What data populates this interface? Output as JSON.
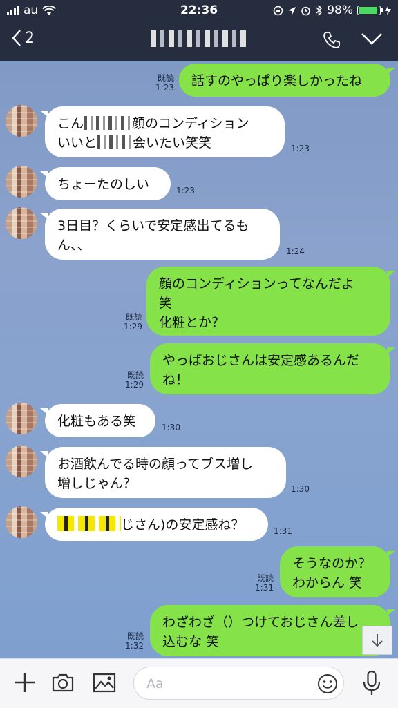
{
  "status": {
    "carrier": "au",
    "time": "22:36",
    "battery": "98%",
    "battery_level": 0.98
  },
  "header": {
    "back_count": "2"
  },
  "messages": [
    {
      "side": "out",
      "text": "話すのやっぱり楽しかったね",
      "read": "既読",
      "time": "1:23"
    },
    {
      "side": "in",
      "pre": "こん",
      "mid": "顔のコンディション\nいいと",
      "post": "会いたい笑笑",
      "time": "1:23"
    },
    {
      "side": "in",
      "text": "ちょーたのしい",
      "time": "1:23"
    },
    {
      "side": "in",
      "text": "3日目？くらいで安定感出てるも\nん、、",
      "time": "1:24"
    },
    {
      "side": "out",
      "text": "顔のコンディションってなんだよ\n笑\n化粧とか？",
      "read": "既読",
      "time": "1:29"
    },
    {
      "side": "out",
      "text": "やっぱおじさんは安定感あるんだ\nね！",
      "read": "既読",
      "time": "1:29"
    },
    {
      "side": "in",
      "text": "化粧もある笑",
      "time": "1:30"
    },
    {
      "side": "in",
      "text": "お酒飲んでる時の顔ってブス増し\n増しじゃん？",
      "time": "1:30"
    },
    {
      "side": "in",
      "text": "じさん)の安定感ね？",
      "time": "1:31"
    },
    {
      "side": "out",
      "text": "そうなのか？\nわからん 笑",
      "read": "既読",
      "time": "1:31"
    },
    {
      "side": "out",
      "text": "わざわざ（）つけておじさん差し\n込むな 笑",
      "read": "既読",
      "time": "1:32"
    }
  ],
  "input": {
    "placeholder": "Aa"
  },
  "icons": {
    "add": "plus-icon",
    "camera": "camera-icon",
    "image": "image-icon",
    "emoji": "smiley-icon",
    "mic": "microphone-icon",
    "phone": "phone-icon",
    "collapse": "chevron-down-icon",
    "scroll": "arrow-down-icon"
  },
  "colors": {
    "header": "#262d3f",
    "out_bubble": "#85e249",
    "in_bubble": "#ffffff",
    "battery": "#4cd964"
  }
}
